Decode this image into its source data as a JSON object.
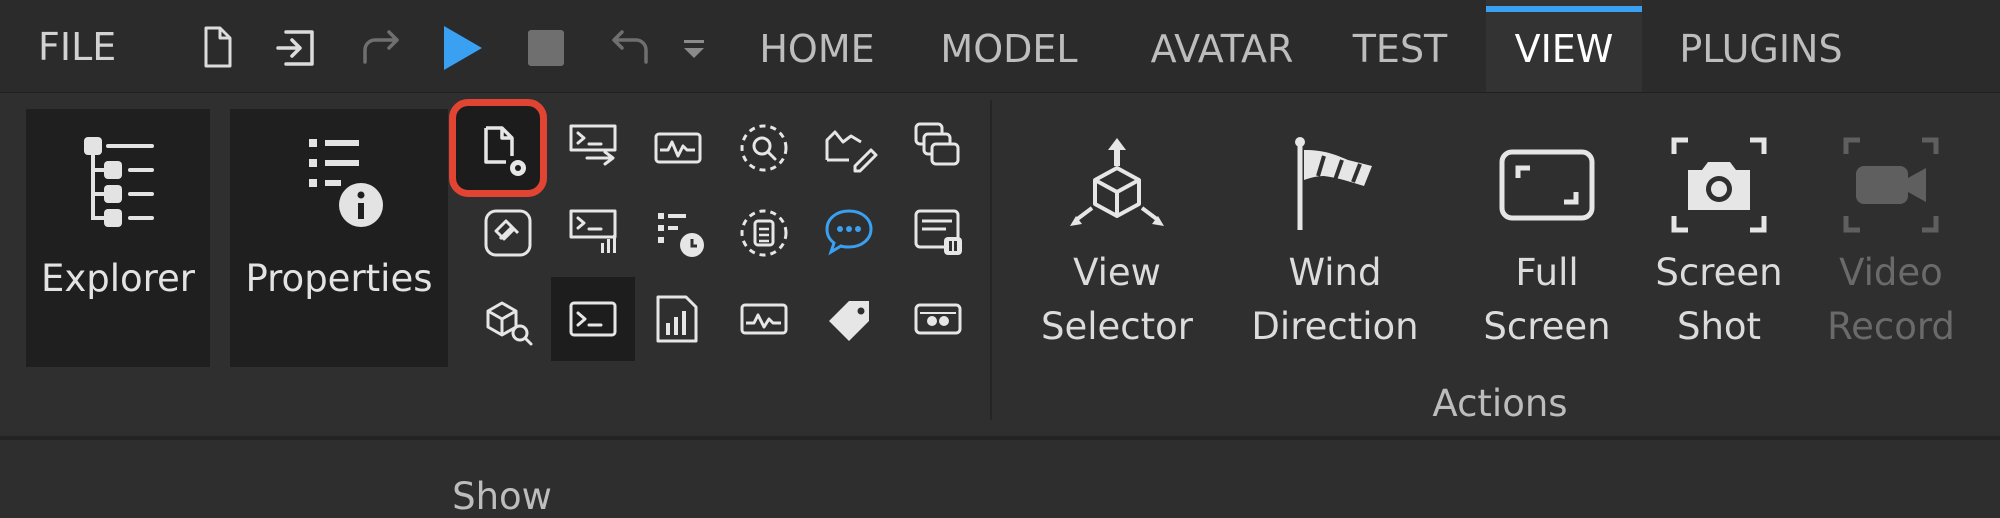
{
  "menu": {
    "file_label": "FILE"
  },
  "tabs": [
    {
      "label": "HOME"
    },
    {
      "label": "MODEL"
    },
    {
      "label": "AVATAR"
    },
    {
      "label": "TEST"
    },
    {
      "label": "VIEW",
      "active": true
    },
    {
      "label": "PLUGINS"
    }
  ],
  "show": {
    "explorer_label": "Explorer",
    "properties_label": "Properties",
    "group_label": "Show"
  },
  "actions": {
    "group_label": "Actions",
    "view_selector": {
      "line1": "View",
      "line2": "Selector"
    },
    "wind_direction": {
      "line1": "Wind",
      "line2": "Direction"
    },
    "full_screen": {
      "line1": "Full",
      "line2": "Screen"
    },
    "screen_shot": {
      "line1": "Screen",
      "line2": "Shot"
    },
    "video_record": {
      "line1": "Video",
      "line2": "Record",
      "disabled": true
    }
  },
  "colors": {
    "accent": "#3aa0f2",
    "highlight": "#e24433",
    "play": "#3aa0f2"
  }
}
